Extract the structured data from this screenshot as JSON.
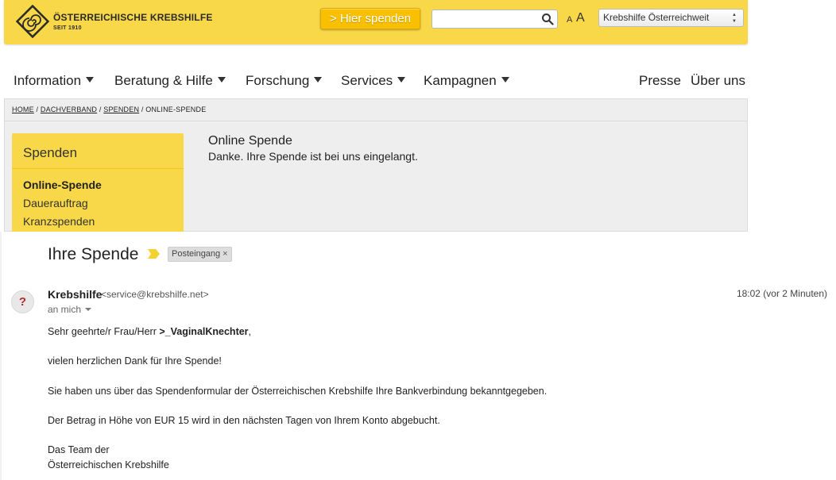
{
  "site": {
    "logo": {
      "name": "ÖSTERREICHISCHE KREBSHILFE",
      "since": "SEIT 1910"
    },
    "donate_button": "> Hier spenden",
    "search": {
      "value": "",
      "placeholder": ""
    },
    "font_size_small": "A",
    "font_size_large": "A",
    "region_select": "Krebshilfe Österreichweit",
    "nav": [
      "Information",
      "Beratung & Hilfe",
      "Forschung",
      "Services",
      "Kampagnen"
    ],
    "nav_right": [
      "Presse",
      "Über uns"
    ],
    "breadcrumb": {
      "home": "HOME",
      "dachverband": "DACHVERBAND",
      "spenden": "SPENDEN",
      "current": "ONLINE-SPENDE",
      "sep": " / "
    },
    "sidebar": {
      "title": "Spenden",
      "items": [
        "Online-Spende",
        "Dauerauftrag",
        "Kranzspenden"
      ]
    },
    "main": {
      "heading": "Online Spende",
      "message": "Danke. Ihre Spende ist bei uns eingelangt."
    },
    "colors": {
      "brand_yellow": "#f8d848",
      "button_yellow": "#f8c000"
    }
  },
  "email": {
    "subject": "Ihre Spende",
    "label": "Posteingang",
    "label_close": "×",
    "sender_name": "Krebshilfe",
    "sender_email": "<service@krebshilfe.net>",
    "recipient": "an mich",
    "time": "18:02 (vor 2 Minuten)",
    "avatar": "?",
    "body": {
      "greeting_prefix": "Sehr geehrte/r Frau/Herr ",
      "greeting_name": ">_VaginalKnechter",
      "greeting_suffix": ",",
      "line1": "vielen herzlichen Dank für Ihre Spende!",
      "line2": "Sie haben uns über das Spendenformular der Österreichischen Krebshilfe Ihre Bankverbindung bekanntgegeben.",
      "line3": "Der Betrag in Höhe von EUR 15 wird in den nächsten Tagen von Ihrem Konto abgebucht.",
      "closing1": "Das Team der",
      "closing2": "Österreichischen Krebshilfe"
    }
  }
}
